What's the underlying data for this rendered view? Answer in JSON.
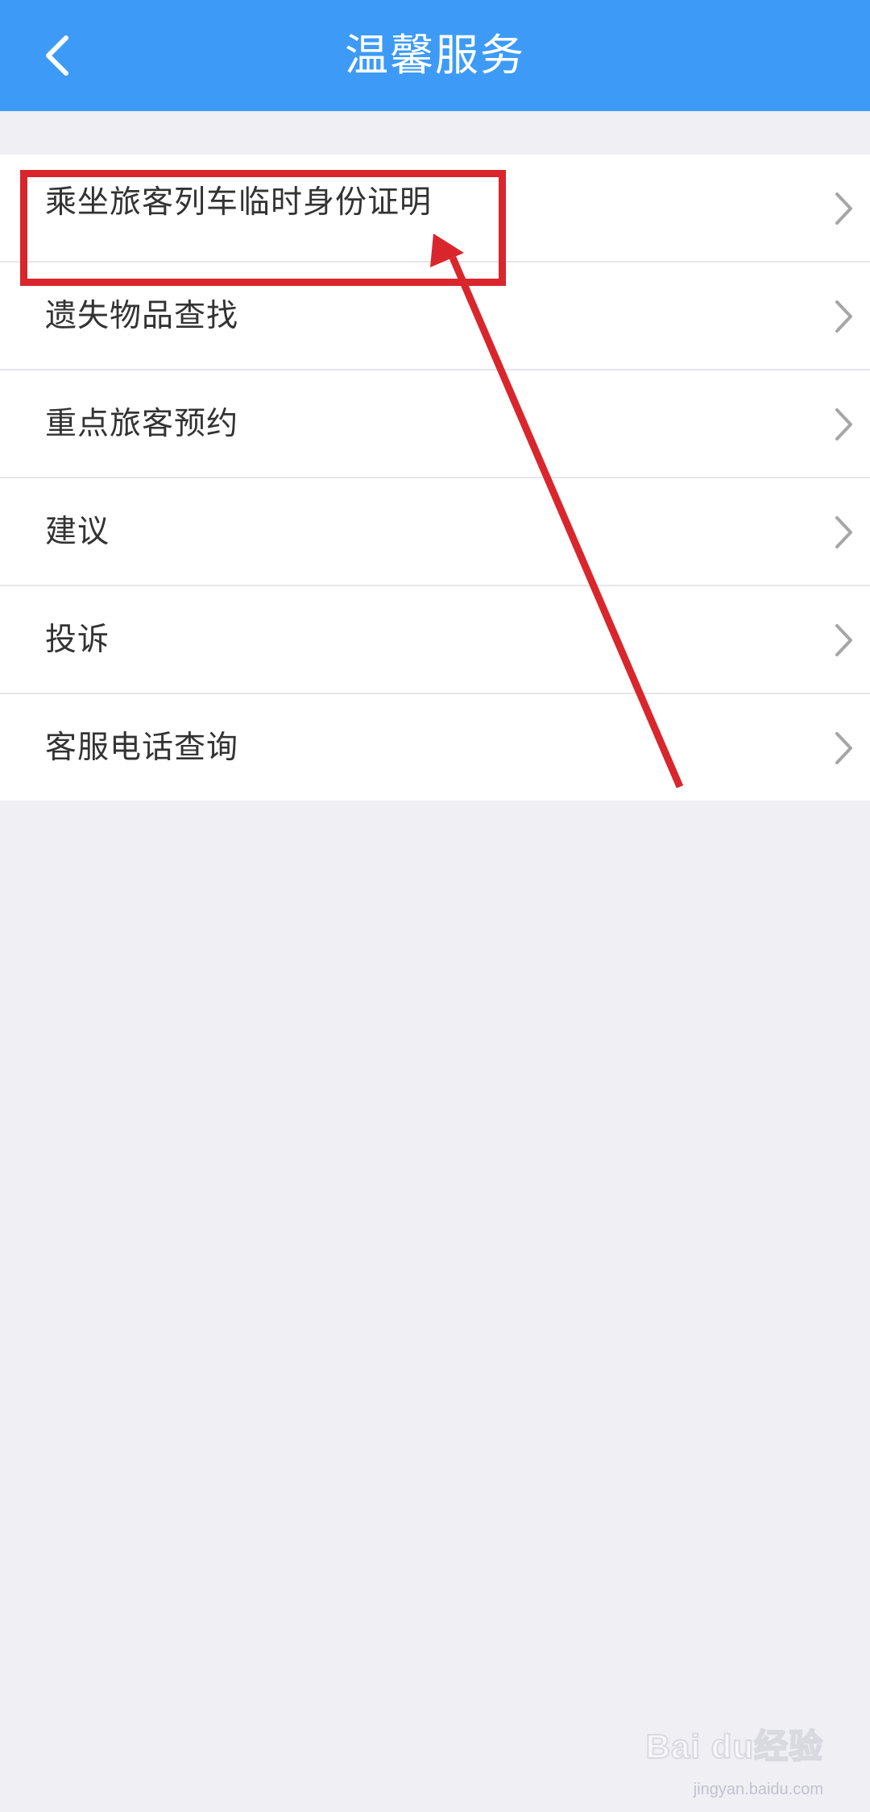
{
  "header": {
    "title": "温馨服务",
    "back_icon": "chevron-left-icon",
    "background_color": "#3d9bf7"
  },
  "services": [
    {
      "label": "乘坐旅客列车临时身份证明"
    },
    {
      "label": "遗失物品查找"
    },
    {
      "label": "重点旅客预约"
    },
    {
      "label": "建议"
    },
    {
      "label": "投诉"
    },
    {
      "label": "客服电话查询"
    }
  ],
  "item_icon": "chevron-right-icon",
  "annotation": {
    "color": "#d9262c",
    "highlighted_item": "乘坐旅客列车临时身份证明"
  },
  "watermark": {
    "brand": "Bai du经验",
    "url": "jingyan.baidu.com"
  }
}
